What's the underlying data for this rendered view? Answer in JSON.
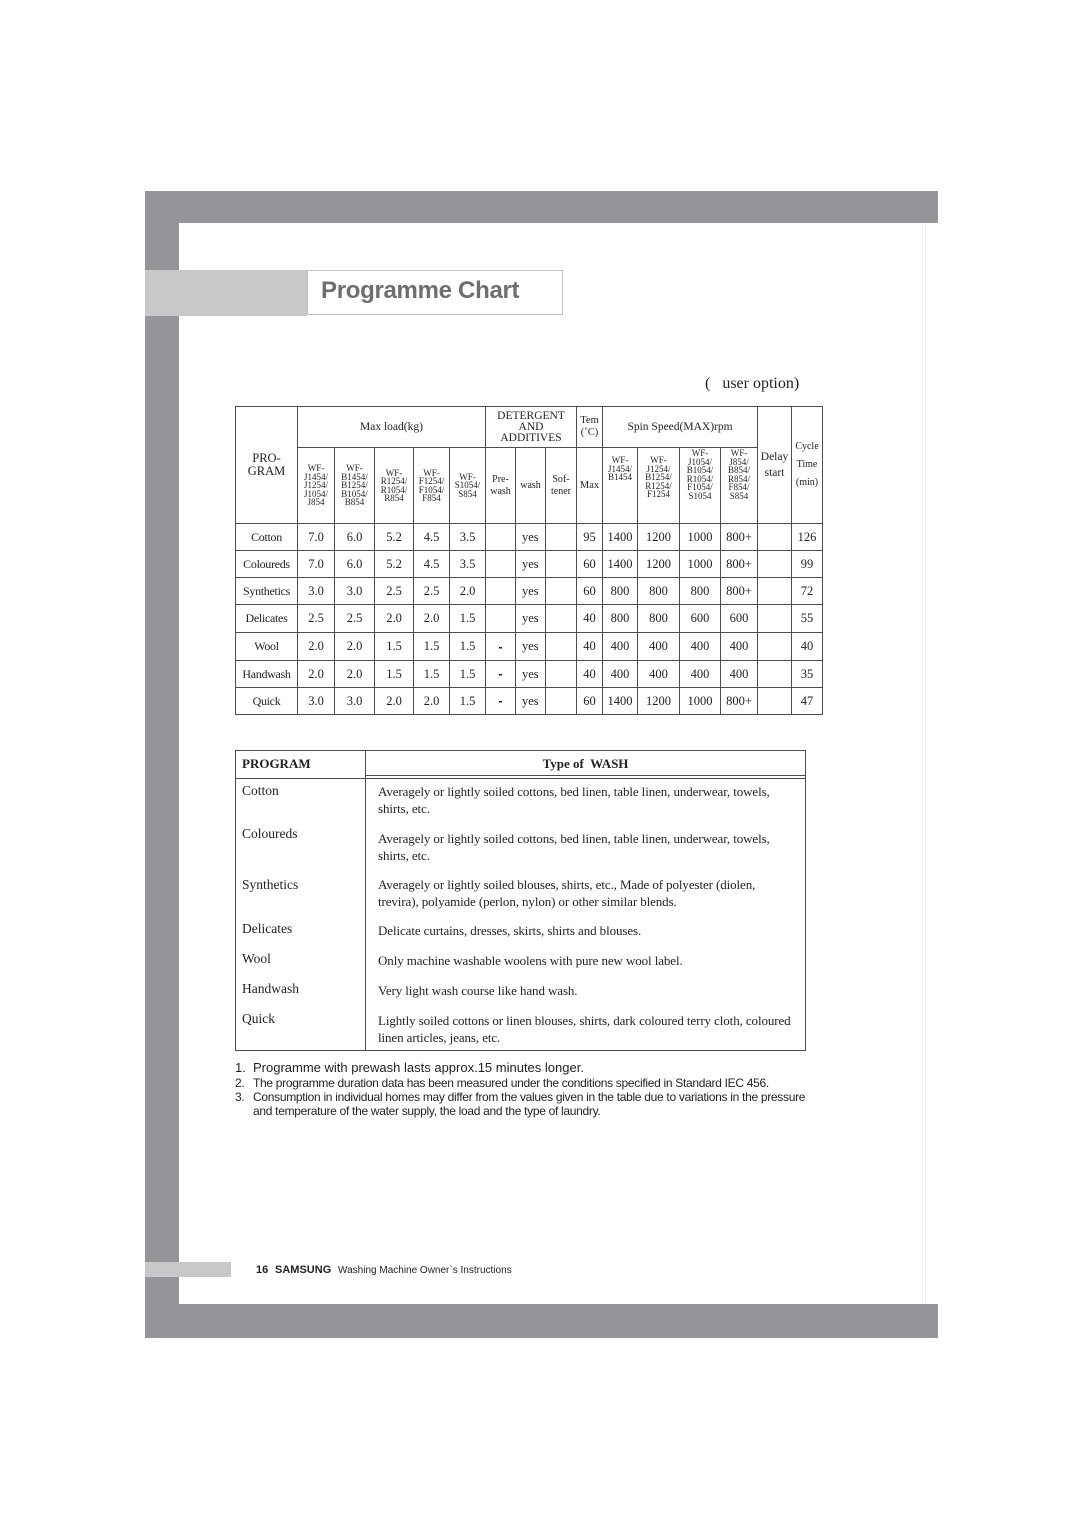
{
  "page": {
    "title": "Programme Chart",
    "user_option_note": "(   user option)",
    "page_number": "16",
    "brand": "SAMSUNG",
    "footer_text": "Washing Machine Owner`s Instructions"
  },
  "programme_table": {
    "headers": {
      "program": [
        "PRO-",
        "GRAM"
      ],
      "max_load": "Max load(kg)",
      "detergent": [
        "DETERGENT",
        "AND",
        "ADDITIVES"
      ],
      "temp": [
        "Tem",
        "(˚C)"
      ],
      "spin_speed": "Spin Speed(MAX)rpm",
      "delay_start": [
        "Delay",
        "start"
      ],
      "cycle_time": [
        "Cycle",
        "Time",
        "(min)"
      ]
    },
    "load_models": [
      [
        "WF-",
        "J1454/",
        "J1254/",
        "J1054/",
        "J854"
      ],
      [
        "WF-",
        "B1454/",
        "B1254/",
        "B1054/",
        "B854"
      ],
      [
        "WF-",
        "R1254/",
        "R1054/",
        "R854"
      ],
      [
        "WF-",
        "F1254/",
        "F1054/",
        "F854"
      ],
      [
        "WF-",
        "S1054/",
        "S854"
      ]
    ],
    "detergent_subs": [
      [
        "Pre-",
        "wash"
      ],
      [
        "wash"
      ],
      [
        "Sof-",
        "tener"
      ]
    ],
    "temp_sub": "Max",
    "spin_models": [
      [
        "WF-",
        "J1454/",
        "B1454"
      ],
      [
        "WF-",
        "J1254/",
        "B1254/",
        "R1254/",
        "F1254"
      ],
      [
        "WF-",
        "J1054/",
        "B1054/",
        "R1054/",
        "F1054/",
        "S1054"
      ],
      [
        "WF-",
        "J854/",
        "B854/",
        "R854/",
        "F854/",
        "S854"
      ]
    ],
    "rows": [
      {
        "program": "Cotton",
        "load": [
          "7.0",
          "6.0",
          "5.2",
          "4.5",
          "3.5"
        ],
        "prewash": "",
        "wash": "yes",
        "softener": "",
        "temp": "95",
        "spin": [
          "1400",
          "1200",
          "1000",
          "800+"
        ],
        "delay": "",
        "cycle": "126"
      },
      {
        "program": "Coloureds",
        "load": [
          "7.0",
          "6.0",
          "5.2",
          "4.5",
          "3.5"
        ],
        "prewash": "",
        "wash": "yes",
        "softener": "",
        "temp": "60",
        "spin": [
          "1400",
          "1200",
          "1000",
          "800+"
        ],
        "delay": "",
        "cycle": "99"
      },
      {
        "program": "Synthetics",
        "load": [
          "3.0",
          "3.0",
          "2.5",
          "2.5",
          "2.0"
        ],
        "prewash": "",
        "wash": "yes",
        "softener": "",
        "temp": "60",
        "spin": [
          "800",
          "800",
          "800",
          "800+"
        ],
        "delay": "",
        "cycle": "72"
      },
      {
        "program": "Delicates",
        "load": [
          "2.5",
          "2.5",
          "2.0",
          "2.0",
          "1.5"
        ],
        "prewash": "",
        "wash": "yes",
        "softener": "",
        "temp": "40",
        "spin": [
          "800",
          "800",
          "600",
          "600"
        ],
        "delay": "",
        "cycle": "55"
      },
      {
        "program": "Wool",
        "load": [
          "2.0",
          "2.0",
          "1.5",
          "1.5",
          "1.5"
        ],
        "prewash": "-",
        "wash": "yes",
        "softener": "",
        "temp": "40",
        "spin": [
          "400",
          "400",
          "400",
          "400"
        ],
        "delay": "",
        "cycle": "40"
      },
      {
        "program": "Handwash",
        "load": [
          "2.0",
          "2.0",
          "1.5",
          "1.5",
          "1.5"
        ],
        "prewash": "-",
        "wash": "yes",
        "softener": "",
        "temp": "40",
        "spin": [
          "400",
          "400",
          "400",
          "400"
        ],
        "delay": "",
        "cycle": "35"
      },
      {
        "program": "Quick",
        "load": [
          "3.0",
          "3.0",
          "2.0",
          "2.0",
          "1.5"
        ],
        "prewash": "-",
        "wash": "yes",
        "softener": "",
        "temp": "60",
        "spin": [
          "1400",
          "1200",
          "1000",
          "800+"
        ],
        "delay": "",
        "cycle": "47"
      }
    ]
  },
  "wash_table": {
    "header_program": "PROGRAM",
    "header_type": "Type of  WASH",
    "rows": [
      {
        "program": "Cotton",
        "description": "Averagely or lightly soiled cottons, bed linen, table linen, underwear, towels, shirts, etc."
      },
      {
        "program": "Coloureds",
        "description": "Averagely or lightly soiled cottons, bed linen, table linen, underwear, towels, shirts, etc."
      },
      {
        "program": "Synthetics",
        "description": "Averagely or lightly soiled blouses, shirts, etc., Made of polyester (diolen, trevira), polyamide (perlon, nylon) or other similar blends."
      },
      {
        "program": "Delicates",
        "description": "Delicate curtains, dresses, skirts, shirts and blouses."
      },
      {
        "program": "Wool",
        "description": "Only machine washable woolens with pure new wool label."
      },
      {
        "program": "Handwash",
        "description": "Very light wash course like hand wash."
      },
      {
        "program": "Quick",
        "description": "Lightly soiled cottons or linen blouses, shirts, dark coloured terry cloth, coloured linen articles, jeans, etc."
      }
    ]
  },
  "notes": [
    {
      "number": "1.",
      "text": "Programme with prewash lasts approx.15 minutes longer."
    },
    {
      "number": "2.",
      "text": "The programme duration data has been measured under the conditions specified in Standard IEC 456."
    },
    {
      "number": "3.",
      "text": "Consumption in individual homes may differ from the values given in the table due to variations in the pressure and temperature of the water supply, the load and the type of laundry."
    }
  ]
}
